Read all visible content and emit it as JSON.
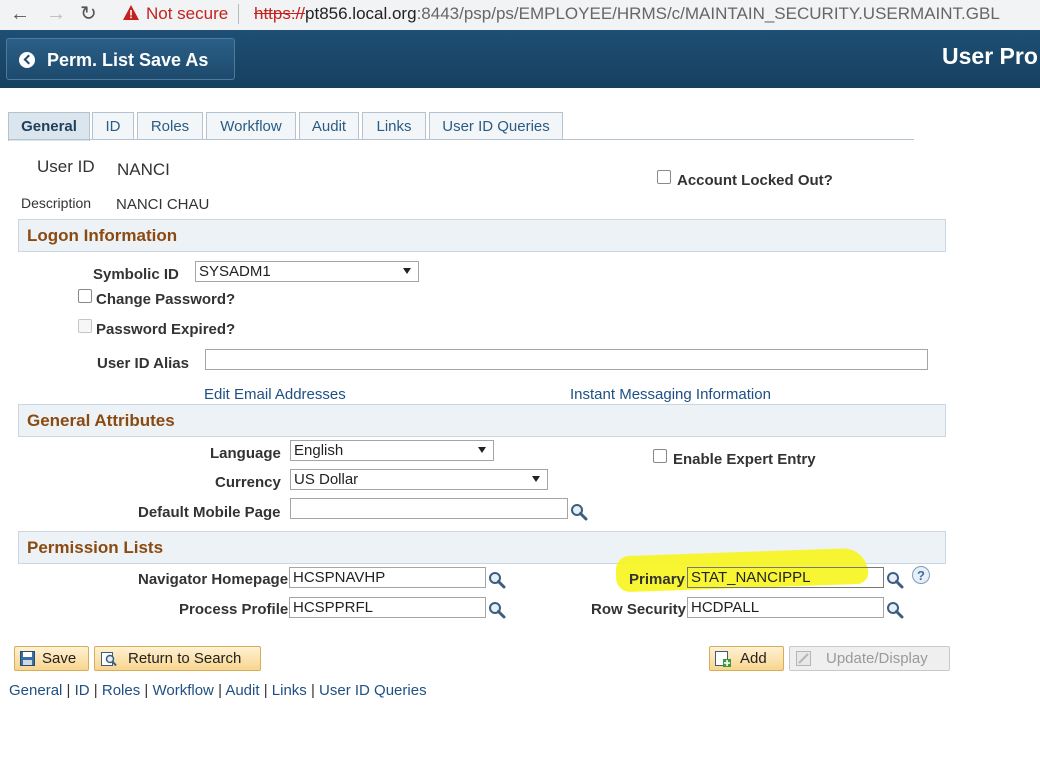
{
  "browser": {
    "security_label": "Not secure",
    "url_scheme": "https://",
    "url_host": "pt856.local.org",
    "url_rest": ":8443/psp/ps/EMPLOYEE/HRMS/c/MAINTAIN_SECURITY.USERMAINT.GBL"
  },
  "header": {
    "back_label": "Perm. List Save As",
    "page_title": "User Pro"
  },
  "tabs": [
    {
      "label": "General"
    },
    {
      "label": "ID"
    },
    {
      "label": "Roles"
    },
    {
      "label": "Workflow"
    },
    {
      "label": "Audit"
    },
    {
      "label": "Links"
    },
    {
      "label": "User ID Queries"
    }
  ],
  "user": {
    "user_id_label": "User ID",
    "user_id_value": "NANCI",
    "description_label": "Description",
    "description_value": "NANCI CHAU",
    "account_locked_label": "Account Locked Out?"
  },
  "logon": {
    "section_title": "Logon Information",
    "symbolic_id_label": "Symbolic ID",
    "symbolic_id_value": "SYSADM1",
    "change_password_label": "Change Password?",
    "password_expired_label": "Password Expired?",
    "alias_label": "User ID Alias",
    "alias_value": "",
    "edit_email_link": "Edit Email Addresses",
    "im_link": "Instant Messaging Information"
  },
  "general_attributes": {
    "section_title": "General Attributes",
    "language_label": "Language",
    "language_value": "English",
    "currency_label": "Currency",
    "currency_value": "US Dollar",
    "mobile_label": "Default Mobile Page",
    "mobile_value": "",
    "expert_entry_label": "Enable Expert Entry"
  },
  "permission_lists": {
    "section_title": "Permission Lists",
    "nav_homepage_label": "Navigator Homepage",
    "nav_homepage_value": "HCSPNAVHP",
    "process_profile_label": "Process Profile",
    "process_profile_value": "HCSPPRFL",
    "primary_label": "Primary",
    "primary_value": "STAT_NANCIPPL",
    "row_security_label": "Row Security",
    "row_security_value": "HCDPALL",
    "help_glyph": "?"
  },
  "buttons": {
    "save": "Save",
    "return_to_search": "Return to Search",
    "add": "Add",
    "update_display": "Update/Display"
  },
  "bottom_nav": {
    "general": "General",
    "id": "ID",
    "roles": "Roles",
    "workflow": "Workflow",
    "audit": "Audit",
    "links": "Links",
    "user_id_queries": "User ID Queries",
    "separator": "|"
  },
  "colors": {
    "header_bg": "#1e4f74",
    "section_title": "#8a4a11",
    "link": "#1f4f83",
    "highlight": "#f7f521"
  }
}
